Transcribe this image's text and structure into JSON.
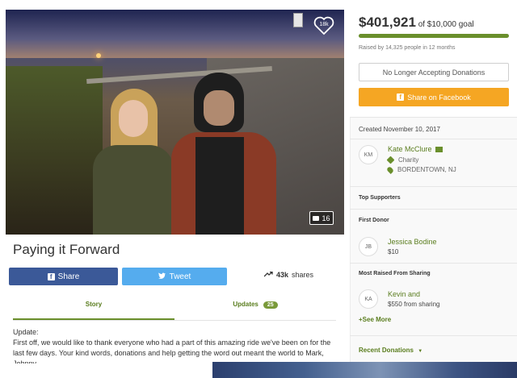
{
  "campaign": {
    "title": "Paying it Forward",
    "like_count": "18k",
    "photo_count": "16"
  },
  "share_bar": {
    "facebook_label": "Share",
    "twitter_label": "Tweet",
    "shares_count": "43k",
    "shares_suffix": "shares"
  },
  "tabs": {
    "story_label": "Story",
    "updates_label": "Updates",
    "updates_count": "25"
  },
  "story": {
    "heading": "Update:",
    "body": "First off, we would like to thank everyone who had a part of this amazing ride we've been on for the last few days. Your kind words, donations and help getting the word out meant the world to Mark, Johnny"
  },
  "donation": {
    "amount": "$401,921",
    "goal_text": "of $10,000 goal",
    "progress": 1.0,
    "raised_by": "Raised by 14,325 people in 12 months",
    "no_longer_label": "No Longer Accepting Donations",
    "share_facebook_label": "Share on Facebook"
  },
  "organizer": {
    "created": "Created November 10, 2017",
    "initials": "KM",
    "name": "Kate McClure",
    "category": "Charity",
    "location": "BORDENTOWN, NJ"
  },
  "supporters": {
    "top_heading": "Top Supporters",
    "first_donor_heading": "First Donor",
    "first_donor": {
      "initials": "JB",
      "name": "Jessica Bodine",
      "amount": "$10"
    },
    "most_raised_heading": "Most Raised From Sharing",
    "most_raised": {
      "initials": "KA",
      "name": "Kevin and",
      "amount": "$550 from sharing"
    },
    "see_more_label": "See More",
    "recent_label": "Recent Donations"
  },
  "colors": {
    "green": "#6a8f2c",
    "facebook": "#3b5998",
    "twitter": "#55acee",
    "orange": "#f5a623"
  }
}
